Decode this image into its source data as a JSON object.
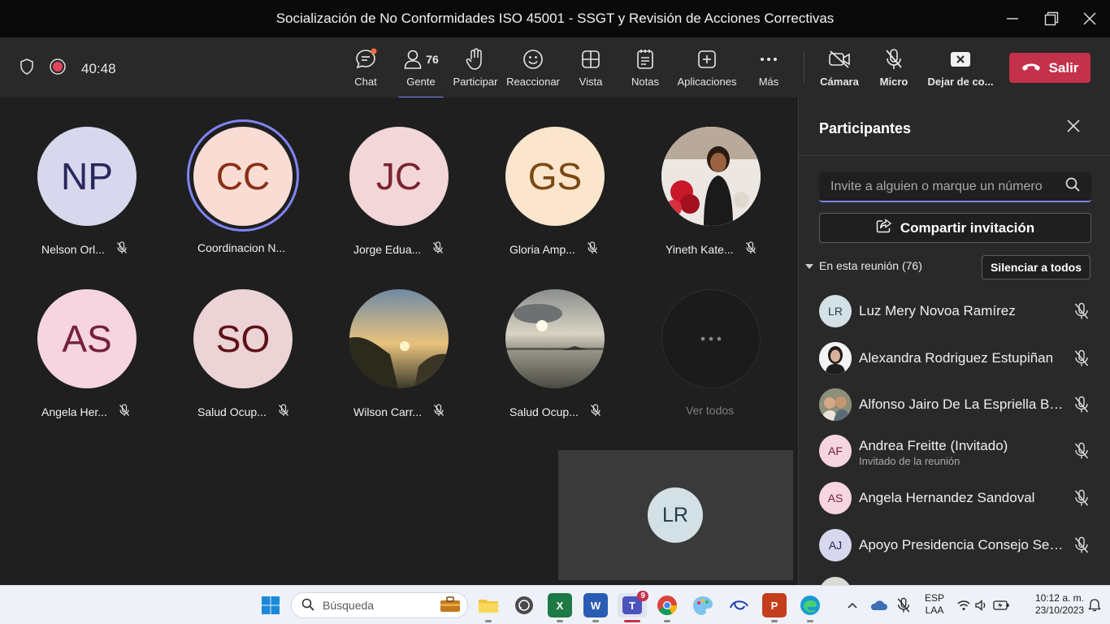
{
  "window": {
    "title": "Socialización de No Conformidades ISO 45001 - SSGT y Revisión de Acciones Correctivas"
  },
  "toolbar": {
    "timer": "40:48",
    "chat": "Chat",
    "people": "Gente",
    "people_count": "76",
    "raise_hand": "Participar",
    "react": "Reaccionar",
    "view": "Vista",
    "notes": "Notas",
    "apps": "Aplicaciones",
    "more": "Más",
    "camera": "Cámara",
    "mic": "Micro",
    "share": "Dejar de co...",
    "leave": "Salir"
  },
  "stage": {
    "tiles": [
      {
        "initials": "NP",
        "name": "Nelson Orl..."
      },
      {
        "initials": "CC",
        "name": "Coordinacion N..."
      },
      {
        "initials": "JC",
        "name": "Jorge Edua..."
      },
      {
        "initials": "GS",
        "name": "Gloria Amp..."
      },
      {
        "initials": "",
        "name": "Yineth Kate..."
      },
      {
        "initials": "AS",
        "name": "Angela Her..."
      },
      {
        "initials": "SO",
        "name": "Salud Ocup..."
      },
      {
        "initials": "",
        "name": "Wilson Carr..."
      },
      {
        "initials": "",
        "name": "Salud Ocup..."
      },
      {
        "initials": "",
        "name": "Ver todos"
      }
    ],
    "self_initials": "LR"
  },
  "panel": {
    "title": "Participantes",
    "search_placeholder": "Invite a alguien o marque un número",
    "share_invite": "Compartir invitación",
    "section_label": "En esta reunión (76)",
    "mute_all": "Silenciar a todos",
    "participants": [
      {
        "initials": "LR",
        "name": "Luz Mery Novoa Ramírez",
        "sub": ""
      },
      {
        "initials": "",
        "name": "Alexandra Rodriguez Estupiñan",
        "sub": ""
      },
      {
        "initials": "",
        "name": "Alfonso Jairo De La Espriella Bur...",
        "sub": ""
      },
      {
        "initials": "AF",
        "name": "Andrea Freitte (Invitado)",
        "sub": "Invitado de la reunión"
      },
      {
        "initials": "AS",
        "name": "Angela Hernandez Sandoval",
        "sub": ""
      },
      {
        "initials": "AJ",
        "name": "Apoyo Presidencia Consejo Secci...",
        "sub": ""
      }
    ]
  },
  "taskbar": {
    "search_label": "Búsqueda",
    "teams_badge": "9",
    "lang_top": "ESP",
    "lang_bottom": "LAA",
    "time": "10:12 a. m.",
    "date": "23/10/2023"
  }
}
